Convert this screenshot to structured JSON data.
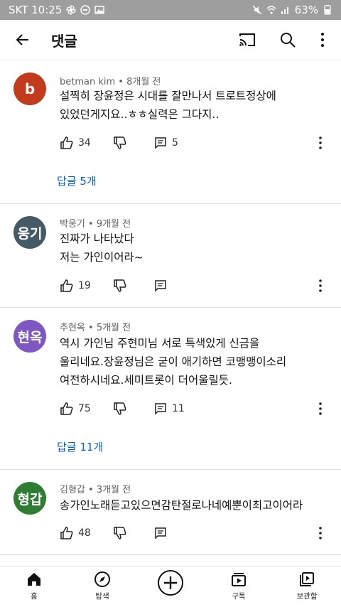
{
  "status_bar": {
    "carrier_time": "SKT 10:25",
    "battery": "63%"
  },
  "app_bar": {
    "title": "댓글"
  },
  "comments": [
    {
      "avatar_letter": "b",
      "avatar_color": "#c23b1c",
      "author": "betman kim",
      "age": "8개월 전",
      "text_lines": [
        "설찍히 장윤정은 시대를 잘만나서 트로트정상에",
        "있었던게지요..ㅎㅎ실력은 그다지.."
      ],
      "likes": "34",
      "replies_count": "5",
      "replies_label": "답글 5개"
    },
    {
      "avatar_letter": "웅기",
      "avatar_color": "#455a64",
      "author": "박웅기",
      "age": "9개월 전",
      "text_lines": [
        "진짜가  나타났다",
        "저는  가인이어라~"
      ],
      "likes": "19"
    },
    {
      "avatar_letter": "현옥",
      "avatar_color": "#7e57c2",
      "author": "추현옥",
      "age": "5개월 전",
      "text_lines": [
        "역시 가인님 주현미님 서로 특색있게 신금을",
        "울리네요.장윤정님은 굳이 애기하면 코맹맹이소리",
        "여전하시네요.세미트롯이 더어울릴듯."
      ],
      "likes": "75",
      "replies_count": "11",
      "replies_label": "답글 11개"
    },
    {
      "avatar_letter": "형갑",
      "avatar_color": "#2e7d32",
      "author": "김형갑",
      "age": "3개월 전",
      "text_lines": [
        "송가인노래듣고있으면감탄절로나네예뿐이최고이어라"
      ],
      "likes": "48"
    }
  ],
  "bottom_nav": {
    "home": "홈",
    "explore": "탐색",
    "subscriptions": "구독",
    "library": "보관함"
  }
}
